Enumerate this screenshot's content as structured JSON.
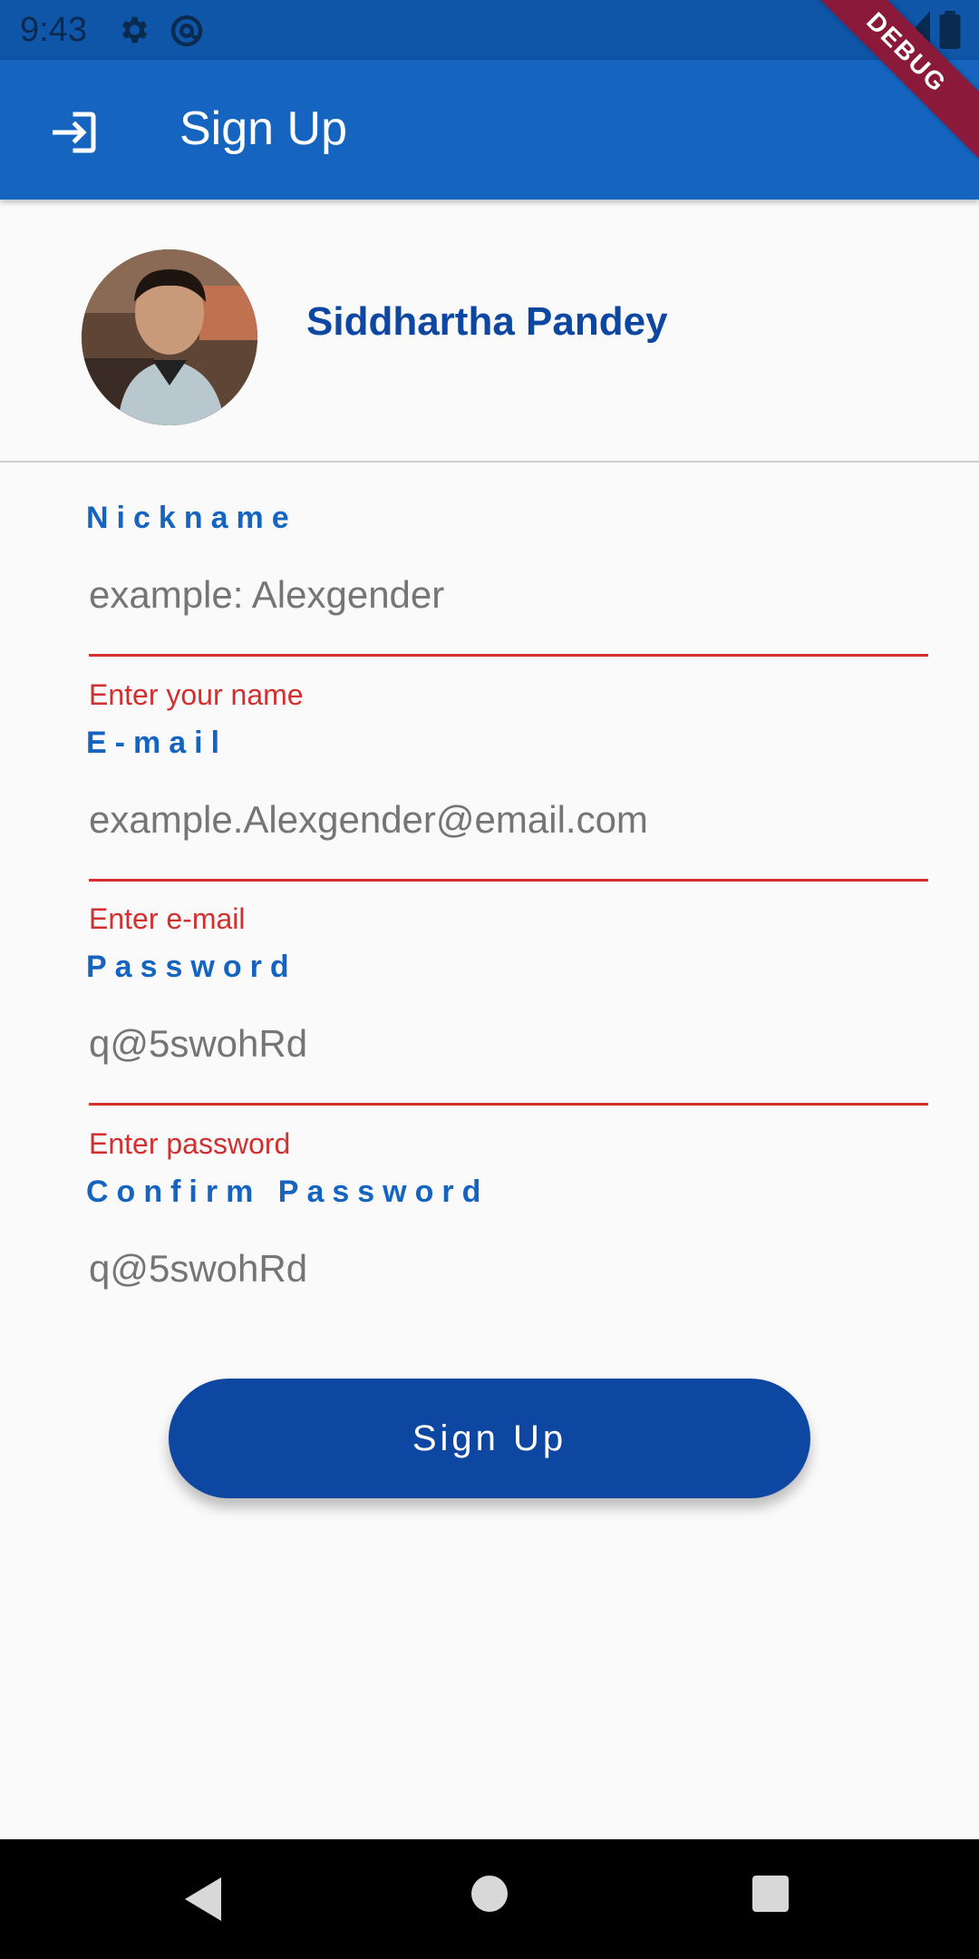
{
  "status_bar": {
    "time": "9:43",
    "icons": [
      "gear-icon",
      "at-sign-icon",
      "wifi-icon",
      "signal-icon",
      "battery-icon"
    ]
  },
  "debug_banner": "DEBUG",
  "app_bar": {
    "title": "Sign Up",
    "icon": "login-icon"
  },
  "profile": {
    "name": "Siddhartha Pandey"
  },
  "form": {
    "fields": [
      {
        "label": "Nickname",
        "placeholder": "example: Alexgender",
        "error": "Enter your name"
      },
      {
        "label": "E-mail",
        "placeholder": "example.Alexgender@email.com",
        "error": "Enter e-mail"
      },
      {
        "label": "Password",
        "placeholder": "q@5swohRd",
        "error": "Enter password"
      },
      {
        "label": "Confirm Password",
        "placeholder": "q@5swohRd",
        "error": ""
      }
    ],
    "submit_label": "Sign Up"
  },
  "nav_bar": {
    "buttons": [
      "back-icon",
      "home-icon",
      "recents-icon"
    ]
  },
  "colors": {
    "primary": "#1565c0",
    "primary_dark": "#0d47a1",
    "error": "#d32f2f",
    "background": "#fafafa"
  }
}
